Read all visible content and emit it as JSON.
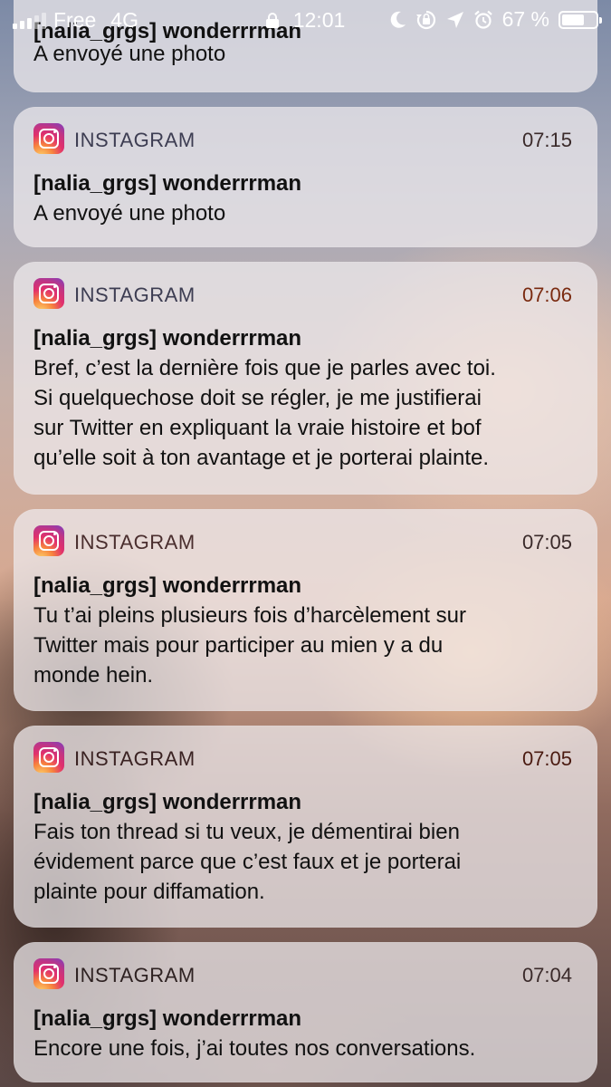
{
  "status_bar": {
    "carrier": "Free",
    "network": "4G",
    "time": "12:01",
    "battery_percent": "67 %",
    "battery_level": 0.67,
    "icons": [
      "signal-icon",
      "lock-icon",
      "moon-icon",
      "rotation-lock-icon",
      "location-icon",
      "alarm-icon",
      "battery-icon"
    ]
  },
  "app": {
    "name": "INSTAGRAM",
    "icon": "instagram-icon",
    "accent": "#e1306c"
  },
  "notifications": [
    {
      "title": "[nalia_grgs] wonderrrman",
      "body": "A envoyé une photo",
      "time": ""
    },
    {
      "app": "INSTAGRAM",
      "time": "07:15",
      "title": "[nalia_grgs] wonderrrman",
      "body": "A envoyé une photo"
    },
    {
      "app": "INSTAGRAM",
      "time": "07:06",
      "title": "[nalia_grgs] wonderrrman",
      "body_lines": [
        "Bref, c’est la dernière fois que je parles avec toi.",
        "Si quelquechose doit se régler, je me justifierai",
        "sur Twitter en expliquant la vraie histoire et bof",
        "qu’elle soit à ton avantage et je porterai plainte."
      ]
    },
    {
      "app": "INSTAGRAM",
      "time": "07:05",
      "title": "[nalia_grgs] wonderrrman",
      "body_lines": [
        "Tu t’ai pleins plusieurs fois d’harcèlement sur",
        "Twitter mais pour participer au mien y a du",
        "monde hein."
      ]
    },
    {
      "app": "INSTAGRAM",
      "time": "07:05",
      "title": "[nalia_grgs] wonderrrman",
      "body_lines": [
        "Fais ton thread si tu veux, je démentirai bien",
        "évidement parce que c’est faux et je porterai",
        "plainte pour diffamation."
      ]
    },
    {
      "app": "INSTAGRAM",
      "time": "07:04",
      "title": "[nalia_grgs] wonderrrman",
      "body_lines": [
        "Encore une fois, j’ai toutes nos conversations."
      ]
    }
  ]
}
